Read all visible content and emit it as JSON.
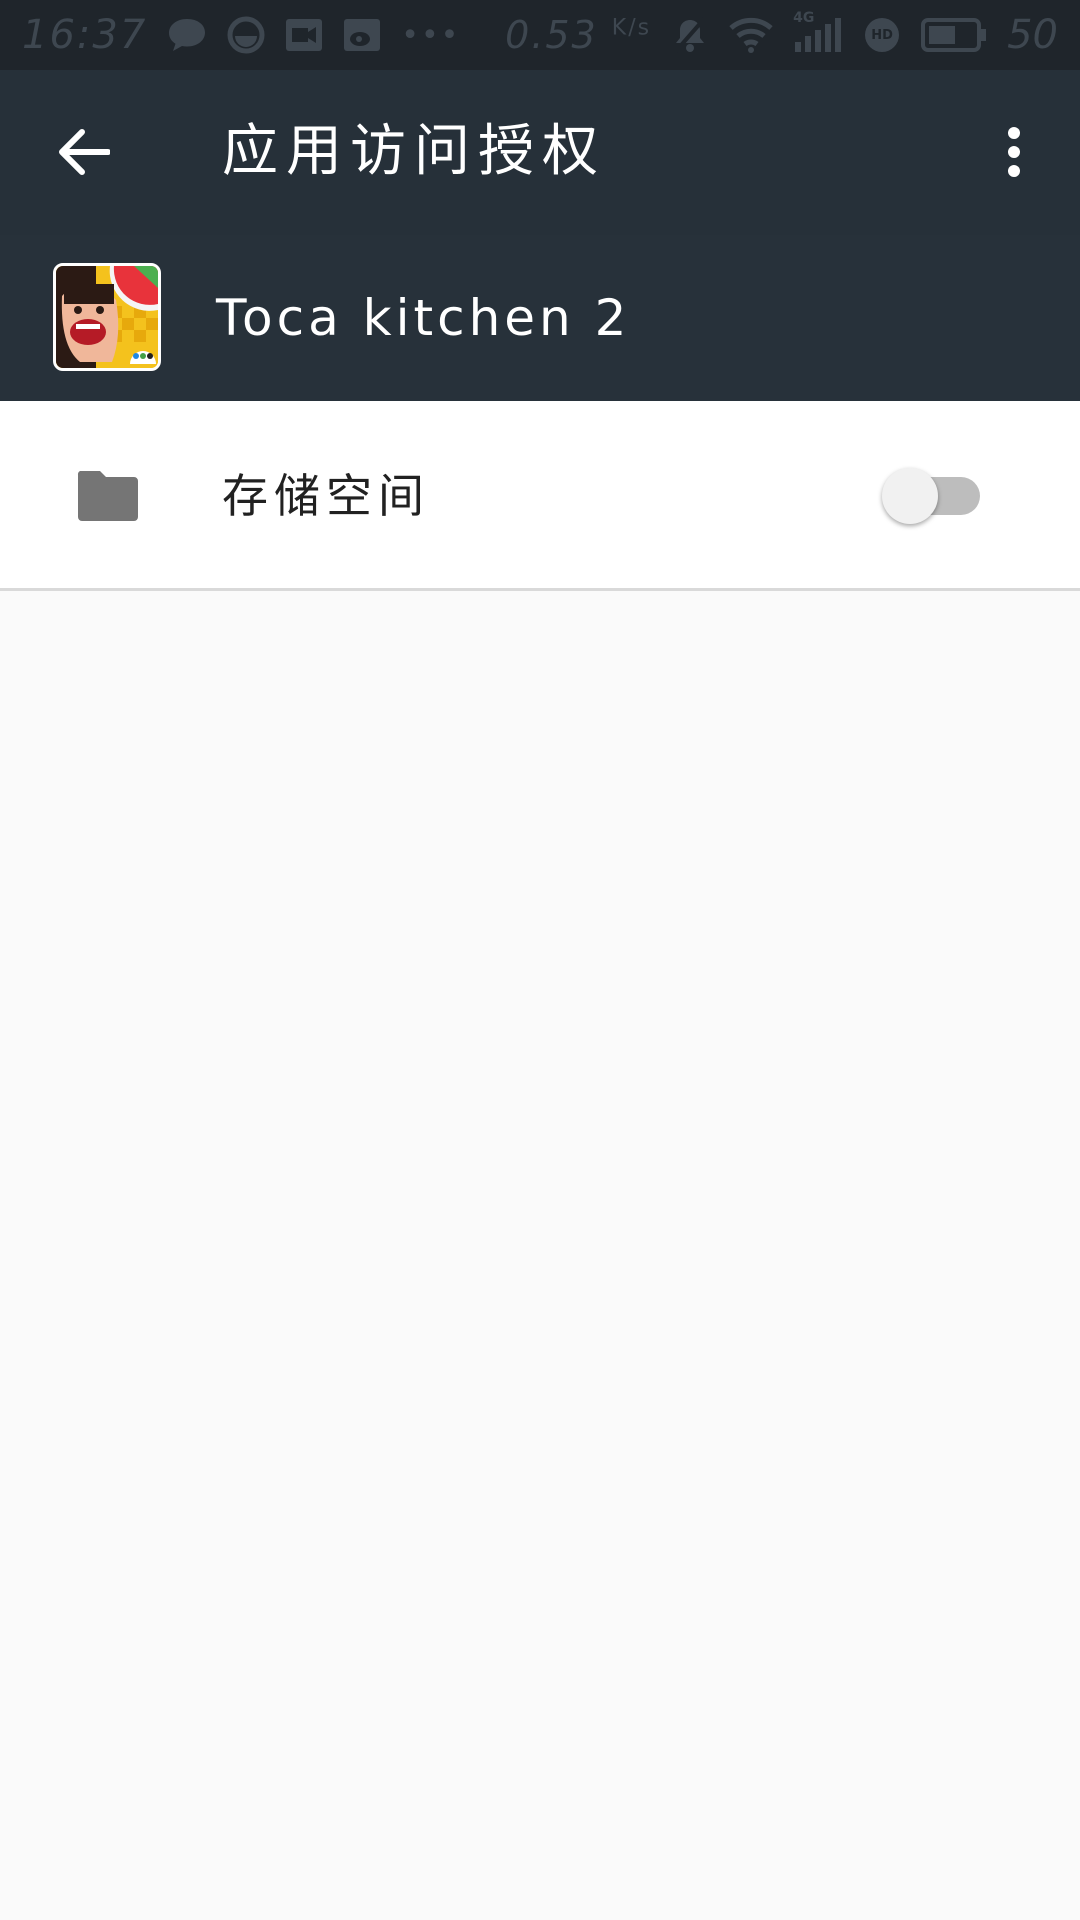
{
  "status_bar": {
    "time": "16:37",
    "net_speed": "0.53",
    "net_speed_unit": "K/s",
    "network_type": "4G",
    "hd_label": "HD",
    "battery": "50",
    "overflow": "•••"
  },
  "toolbar": {
    "title": "应用访问授权"
  },
  "app": {
    "name": "Toca kitchen 2"
  },
  "permissions": [
    {
      "label": "存储空间",
      "icon": "folder-icon",
      "enabled": false
    }
  ],
  "colors": {
    "status_bar_bg": "#1f252b",
    "toolbar_bg": "#263039",
    "app_header_bg": "#27313a",
    "page_bg": "#fafafa",
    "toggle_off_track": "#bdbdbd"
  }
}
